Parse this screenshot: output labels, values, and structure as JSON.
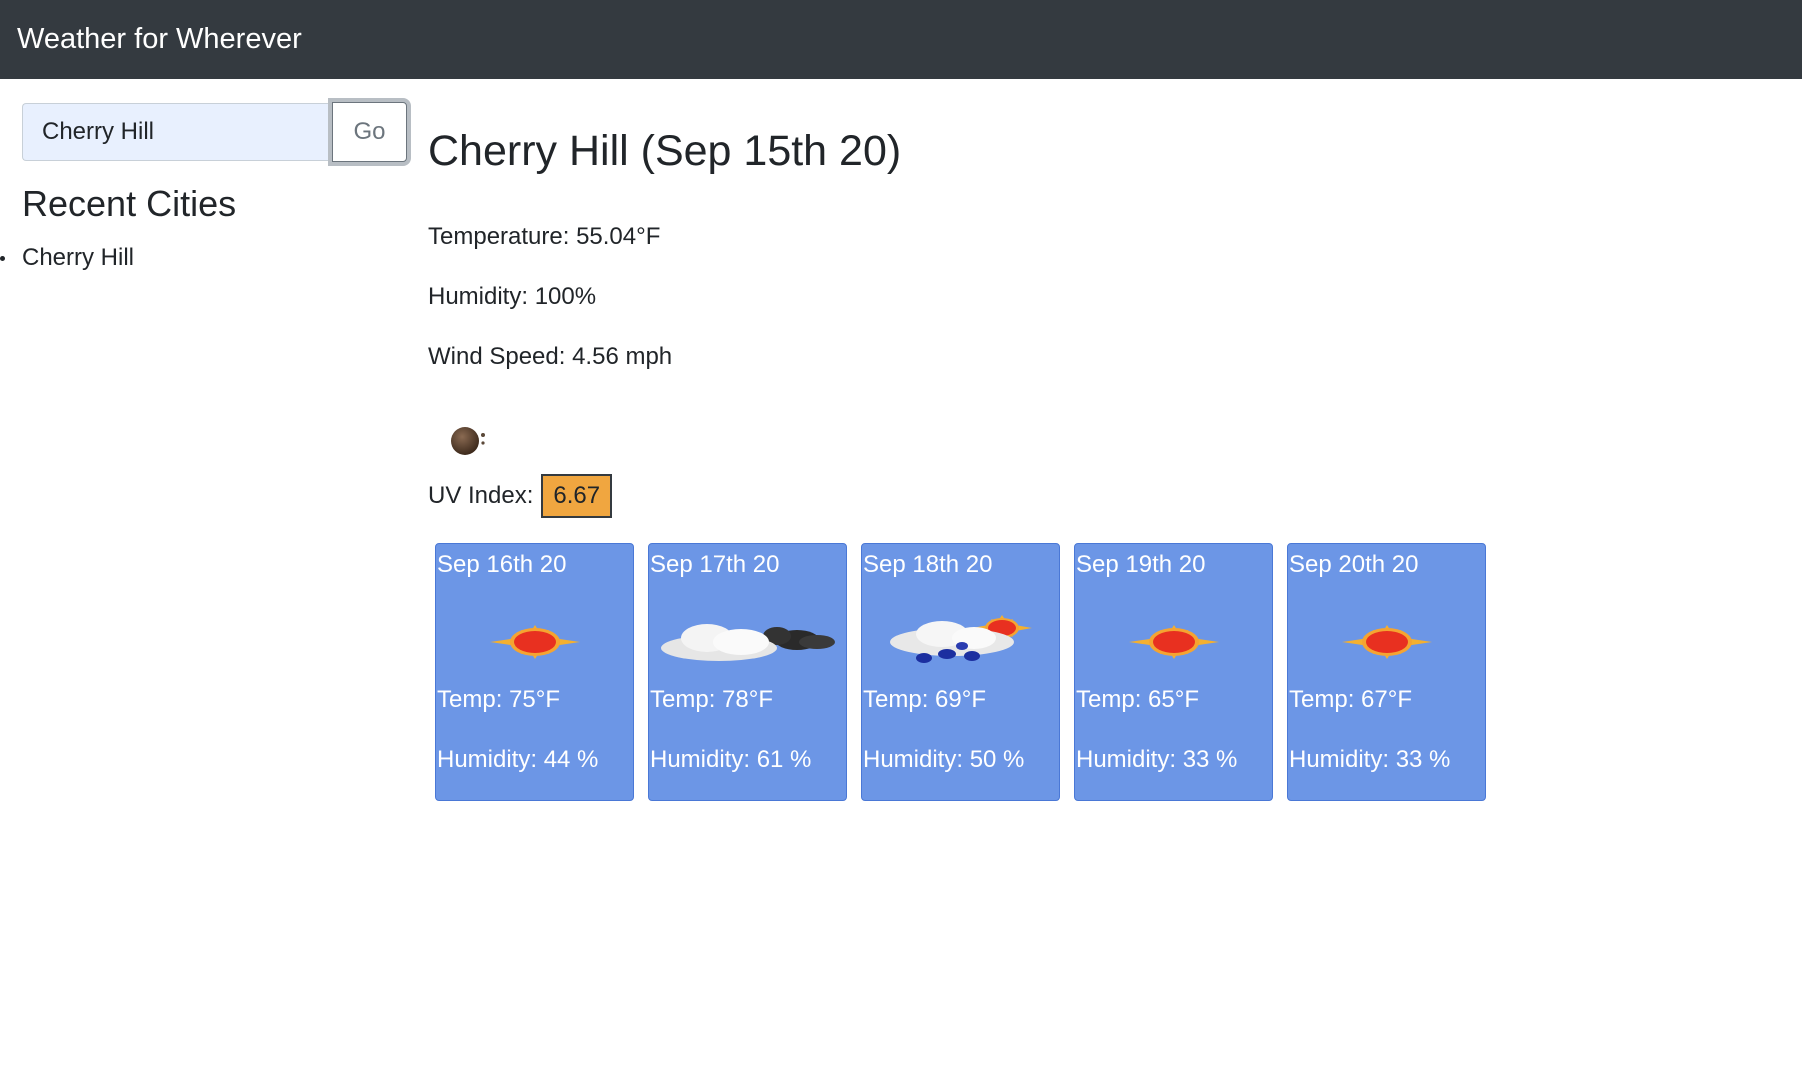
{
  "navbar": {
    "title": "Weather for Wherever"
  },
  "search": {
    "value": "Cherry Hill",
    "button_label": "Go"
  },
  "recent": {
    "title": "Recent Cities",
    "cities": [
      "Cherry Hill"
    ]
  },
  "current": {
    "title": "Cherry Hill (Sep 15th 20)",
    "temperature": "Temperature: 55.04°F",
    "humidity": "Humidity: 100%",
    "wind": "Wind Speed: 4.56 mph",
    "icon": "moon-icon",
    "uv_label": "UV Index:",
    "uv_value": "6.67",
    "uv_color": "#f0a640"
  },
  "forecast": [
    {
      "date": "Sep 16th 20",
      "icon": "sun-icon",
      "temp": "Temp: 75°F",
      "humidity": "Humidity: 44 %"
    },
    {
      "date": "Sep 17th 20",
      "icon": "clouds-icon",
      "temp": "Temp: 78°F",
      "humidity": "Humidity: 61 %"
    },
    {
      "date": "Sep 18th 20",
      "icon": "sun-cloud-rain-icon",
      "temp": "Temp: 69°F",
      "humidity": "Humidity: 50 %"
    },
    {
      "date": "Sep 19th 20",
      "icon": "sun-icon",
      "temp": "Temp: 65°F",
      "humidity": "Humidity: 33 %"
    },
    {
      "date": "Sep 20th 20",
      "icon": "sun-icon",
      "temp": "Temp: 67°F",
      "humidity": "Humidity: 33 %"
    }
  ],
  "colors": {
    "navbar": "#343a40",
    "card": "#6c96e6",
    "uv": "#f0a640"
  }
}
